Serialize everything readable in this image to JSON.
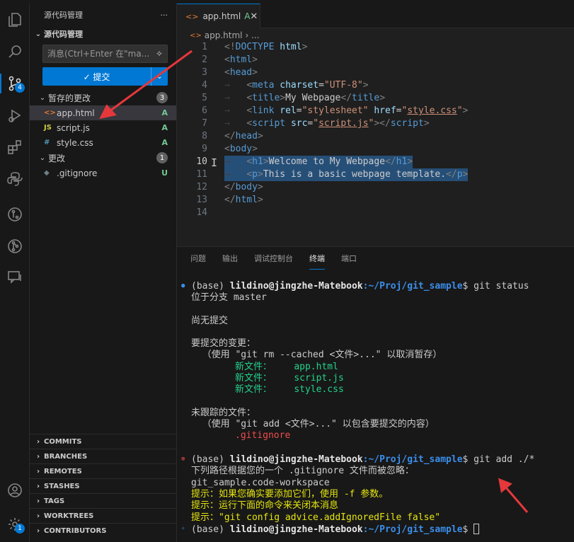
{
  "sidebar": {
    "view_title": "源代码管理",
    "more": "···",
    "section_title": "源代码管理",
    "commit_placeholder": "消息(Ctrl+Enter 在\"ma...",
    "commit_label": "✓ 提交",
    "staged": {
      "label": "暂存的更改",
      "count": "3"
    },
    "changes": {
      "label": "更改",
      "count": "1"
    },
    "staged_files": [
      {
        "name": "app.html",
        "status": "A",
        "icon": "<>"
      },
      {
        "name": "script.js",
        "status": "A",
        "icon": "JS"
      },
      {
        "name": "style.css",
        "status": "A",
        "icon": "#"
      }
    ],
    "change_files": [
      {
        "name": ".gitignore",
        "status": "U",
        "icon": "◆"
      }
    ],
    "panels": [
      "COMMITS",
      "BRANCHES",
      "REMOTES",
      "STASHES",
      "TAGS",
      "WORKTREES",
      "CONTRIBUTORS"
    ]
  },
  "activity": {
    "scm_badge": "4",
    "manage_badge": "1"
  },
  "tab": {
    "label": "app.html",
    "modified": "A",
    "close": "✕"
  },
  "breadcrumb": {
    "file": "app.html",
    "sep": "› ..."
  },
  "editor": {
    "line_numbers": [
      "1",
      "2",
      "3",
      "4",
      "5",
      "6",
      "7",
      "8",
      "9",
      "10",
      "11",
      "12",
      "13",
      "14"
    ],
    "current_line": "10"
  },
  "panel_tabs": [
    "问题",
    "输出",
    "调试控制台",
    "终端",
    "端口"
  ],
  "active_panel_tab": "终端",
  "terminal": {
    "prompt_base": "(base) ",
    "prompt_user": "lildino@jingzhe-Matebook",
    "prompt_path": ":~/Proj/git_sample",
    "cmd1": "$ git status",
    "l1": "位于分支 master",
    "l2": "尚无提交",
    "l3": "要提交的变更：",
    "l4": "  （使用 \"git rm --cached <文件>...\" 以取消暂存）",
    "new_file_label": "新文件：",
    "staged_new": [
      "app.html",
      "script.js",
      "style.css"
    ],
    "l5": "未跟踪的文件：",
    "l6": "  （使用 \"git add <文件>...\" 以包含要提交的内容）",
    "untracked": ".gitignore",
    "cmd2": "$ git add ./*",
    "l7": "下列路径根据您的一个 .gitignore 文件而被忽略：",
    "l8": "git_sample.code-workspace",
    "h1": "提示：如果您确实要添加它们，使用 -f 参数。",
    "h2": "提示：运行下面的命令来关闭本消息",
    "h3": "提示：\"git config advice.addIgnoredFile false\"",
    "cmd3": "$ "
  },
  "colors": {
    "accent": "#0078d4",
    "arrow": "#e5383b"
  }
}
